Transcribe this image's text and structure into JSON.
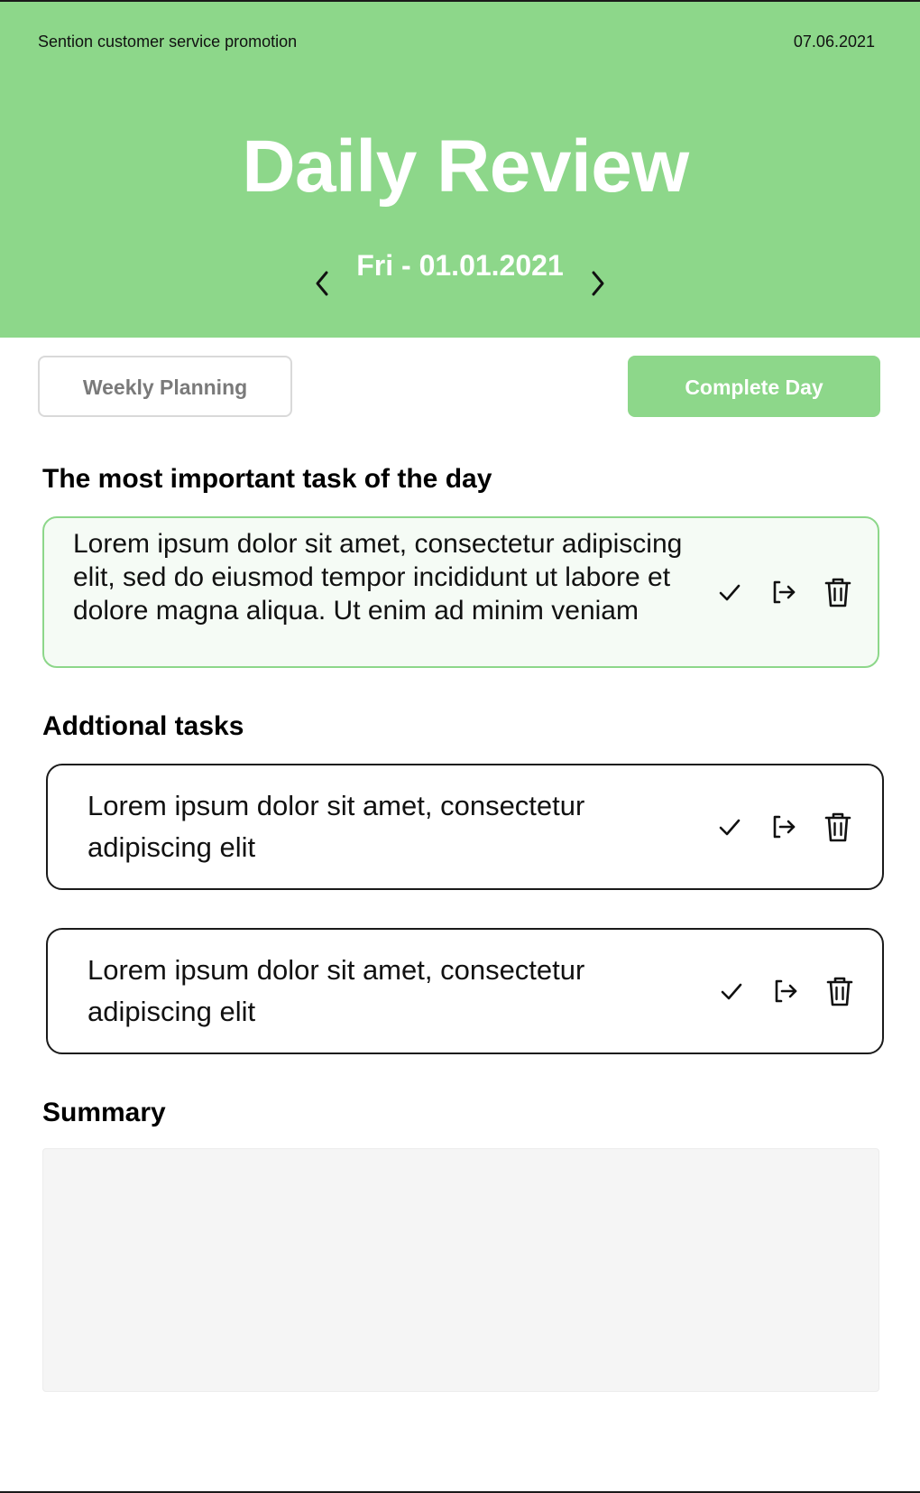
{
  "header": {
    "project_name": "Sention customer service promotion",
    "date": "07.06.2021",
    "title": "Daily Review",
    "current_day": "Fri - 01.01.2021",
    "background_color": "#8dd78a"
  },
  "toolbar": {
    "weekly_planning_label": "Weekly Planning",
    "complete_day_label": "Complete Day"
  },
  "main_task": {
    "section_title": "The most important task of the day",
    "text": "Lorem ipsum dolor sit amet, consectetur adipiscing elit, sed do eiusmod tempor incididunt ut labore et dolore magna aliqua. Ut enim ad minim veniam",
    "actions": [
      "check-icon",
      "move-icon",
      "trash-icon"
    ]
  },
  "additional_tasks": {
    "section_title": "Addtional tasks",
    "items": [
      {
        "text": "Lorem ipsum dolor sit amet, consectetur adipiscing elit"
      },
      {
        "text": "Lorem ipsum dolor sit amet, consectetur adipiscing elit"
      }
    ]
  },
  "summary": {
    "section_title": "Summary",
    "value": ""
  },
  "icons": {
    "prev": "chevron-left-icon",
    "next": "chevron-right-icon",
    "complete": "check-icon",
    "move": "move-icon",
    "delete": "trash-icon"
  },
  "colors": {
    "accent": "#8dd78a",
    "main_task_bg": "#f5fbf5",
    "summary_bg": "#f5f5f5"
  }
}
